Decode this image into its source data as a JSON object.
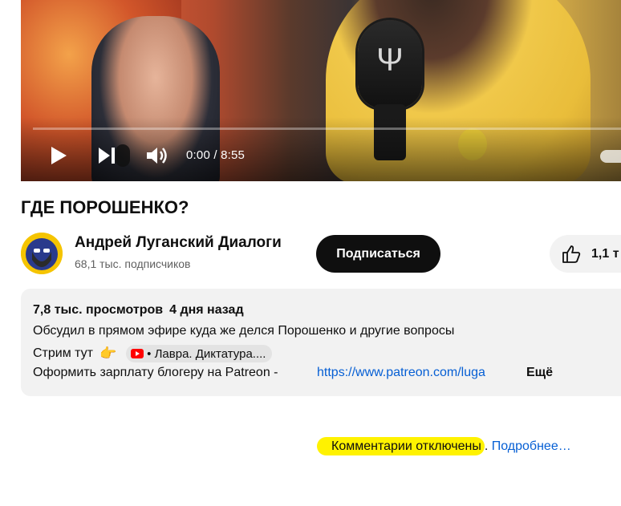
{
  "player": {
    "time": "0:00 / 8:55",
    "progress_fraction": 0.0
  },
  "video": {
    "title": "ГДЕ ПОРОШЕНКО?"
  },
  "channel": {
    "name": "Андрей Луганский Диалоги",
    "subscribers": "68,1 тыс. подписчиков",
    "subscribe_label": "Подписаться",
    "like_count": "1,1 т"
  },
  "description": {
    "views": "7,8 тыс. просмотров",
    "date": "4 дня назад",
    "line1": "Обсудил в прямом эфире куда же делся Порошенко и другие вопросы",
    "line2_prefix": "Стрим тут",
    "line2_emoji": "👉",
    "stream_chip": "• Лавра. Диктатура....",
    "line3_prefix": "Оформить зарплату блогеру на Patreon -",
    "patreon_link": "https://www.patreon.com/luga",
    "more_label": "Ещё"
  },
  "comments": {
    "disabled_text": "Комментарии отключены",
    "separator": ".",
    "learn_more": "Подробнее…"
  },
  "colors": {
    "accent_link": "#065fd4",
    "highlight": "#fff200",
    "subscribe_bg": "#0f0f0f"
  },
  "icons": [
    "play-icon",
    "next-icon",
    "volume-icon",
    "like-icon",
    "youtube-icon",
    "pointing-hand-icon"
  ]
}
